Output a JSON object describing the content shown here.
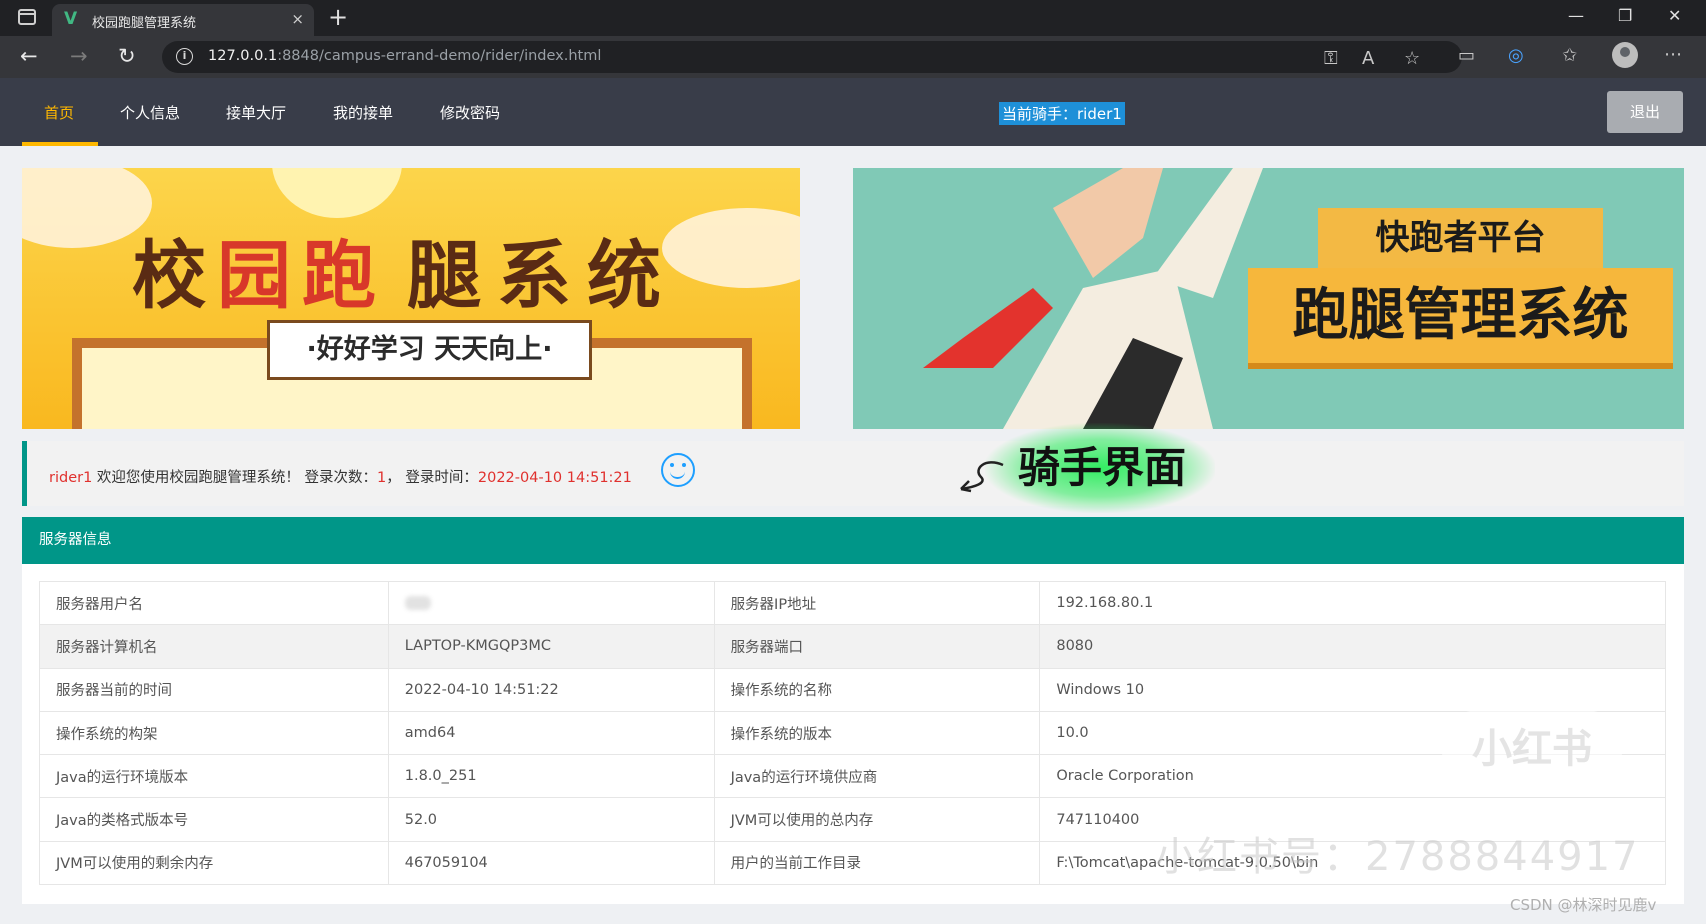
{
  "browser": {
    "tab_title": "校园跑腿管理系统",
    "tab_logo": "V",
    "tab_close": "×",
    "new_tab": "+",
    "url_host": "127.0.0.1",
    "url_rest": ":8848/campus-errand-demo/rider/index.html",
    "window_controls": [
      "—",
      "❐",
      "✕"
    ],
    "icons": [
      "window-icon",
      "back-icon",
      "forward-icon",
      "reload-icon",
      "info-icon",
      "key-icon",
      "read-aloud-icon",
      "add-favorite-icon",
      "split-screen-icon",
      "edge-copilot-icon",
      "favorites-icon",
      "profile-icon",
      "more-icon"
    ]
  },
  "nav": {
    "items": [
      "首页",
      "个人信息",
      "接单大厅",
      "我的接单",
      "修改密码"
    ],
    "active_index": 0,
    "current_rider": "当前骑手：rider1",
    "logout": "退出"
  },
  "banners": {
    "left_title": [
      "校",
      "园",
      "跑",
      "腿",
      "系",
      "统"
    ],
    "left_motto": "·好好学习 天天向上·",
    "right_line1": "快跑者平台",
    "right_line2": "跑腿管理系统"
  },
  "welcome": {
    "user": "rider1",
    "text1": " 欢迎您使用校园跑腿管理系统！ 登录次数：",
    "login_count": "1",
    "text2": "， 登录时间：",
    "login_time": "2022-04-10 14:51:21"
  },
  "overlay_label": "骑手界面",
  "server_panel": {
    "title": "服务器信息",
    "rows": [
      [
        "服务器用户名",
        "",
        "服务器IP地址",
        "192.168.80.1"
      ],
      [
        "服务器计算机名",
        "LAPTOP-KMGQP3MC",
        "服务器端口",
        "8080"
      ],
      [
        "服务器当前的时间",
        "2022-04-10 14:51:22",
        "操作系统的名称",
        "Windows 10"
      ],
      [
        "操作系统的构架",
        "amd64",
        "操作系统的版本",
        "10.0"
      ],
      [
        "Java的运行环境版本",
        "1.8.0_251",
        "Java的运行环境供应商",
        "Oracle Corporation"
      ],
      [
        "Java的类格式版本号",
        "52.0",
        "JVM可以使用的总内存",
        "747110400"
      ],
      [
        "JVM可以使用的剩余内存",
        "467059104",
        "用户的当前工作目录",
        "F:\\Tomcat\\apache-tomcat-9.0.50\\bin"
      ]
    ]
  },
  "watermarks": {
    "logo": "小红书",
    "id_text": "小红书号：2788844917",
    "csdn": "CSDN @林深时见鹿v"
  },
  "colors": {
    "nav_bg": "#393d49",
    "nav_active": "#ffb800",
    "teal": "#009688",
    "highlight": "#e0312e",
    "rider_badge": "#1e90d8"
  }
}
